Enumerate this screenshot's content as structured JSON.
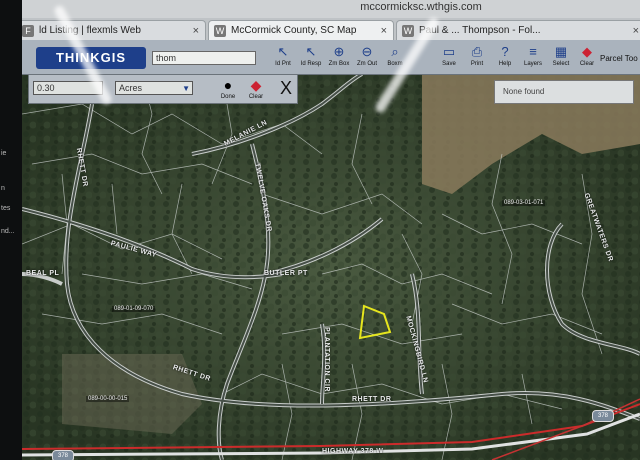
{
  "browser": {
    "url": "mccormicksc.wthgis.com",
    "tabs": [
      {
        "label": "ld Listing | flexmls Web",
        "icon": "flexmls-icon",
        "active": false
      },
      {
        "label": "McCormick County, SC Map",
        "icon": "w-icon",
        "active": true
      },
      {
        "label": "Paul & ... Thompson - Fol...",
        "icon": "w-icon",
        "active": false
      }
    ],
    "close_glyph": "×"
  },
  "sidebar_fragments": [
    "ie",
    "n",
    "tes",
    "nd..."
  ],
  "toolbar": {
    "logo": "THINKGIS",
    "search_value": "thom",
    "tools": [
      {
        "label": "Id Pnt",
        "icon": "pointer-icon",
        "glyph": "↖"
      },
      {
        "label": "Id Resp",
        "icon": "pointer-info-icon",
        "glyph": "↖"
      },
      {
        "label": "Zm Box",
        "icon": "zoom-in-icon",
        "glyph": "⊕"
      },
      {
        "label": "Zm Out",
        "icon": "zoom-out-icon",
        "glyph": "⊖"
      },
      {
        "label": "Boxm",
        "icon": "zoom-box-icon",
        "glyph": "⌕"
      },
      {
        "label": "Save",
        "icon": "save-icon",
        "glyph": "▭"
      },
      {
        "label": "Print",
        "icon": "print-icon",
        "glyph": "⎙"
      },
      {
        "label": "Help",
        "icon": "help-icon",
        "glyph": "?"
      },
      {
        "label": "Layers",
        "icon": "layers-icon",
        "glyph": "≡"
      },
      {
        "label": "Select",
        "icon": "select-icon",
        "glyph": "▦"
      },
      {
        "label": "Clear",
        "icon": "eraser-icon",
        "glyph": "◆"
      }
    ],
    "parcel_tool_label": "Parcel Too"
  },
  "buffer": {
    "distance_value": "0.30",
    "unit_value": "Acres",
    "done_label": "Done",
    "clear_label": "Clear",
    "close_glyph": "X"
  },
  "result": {
    "text": "None found"
  },
  "map": {
    "roads": [
      "MELANIE LN",
      "RHETT DR",
      "PAULIE WAY",
      "BEAL PL",
      "TWELVE OAKS DR",
      "BUTLER PT",
      "PLANTATION CIR",
      "MOCKINGBIRD LN",
      "HIGHWAY 378 W",
      "GREATWATERS DR"
    ],
    "parcel_ids": [
      "089-01-09-070",
      "089-00-00-015",
      "089-03-01-071"
    ],
    "route_shield": "378",
    "colors": {
      "highlight": "#e6e61e",
      "roads": "#d9dcdc",
      "parcel_lines": "#cfd4d2"
    }
  }
}
